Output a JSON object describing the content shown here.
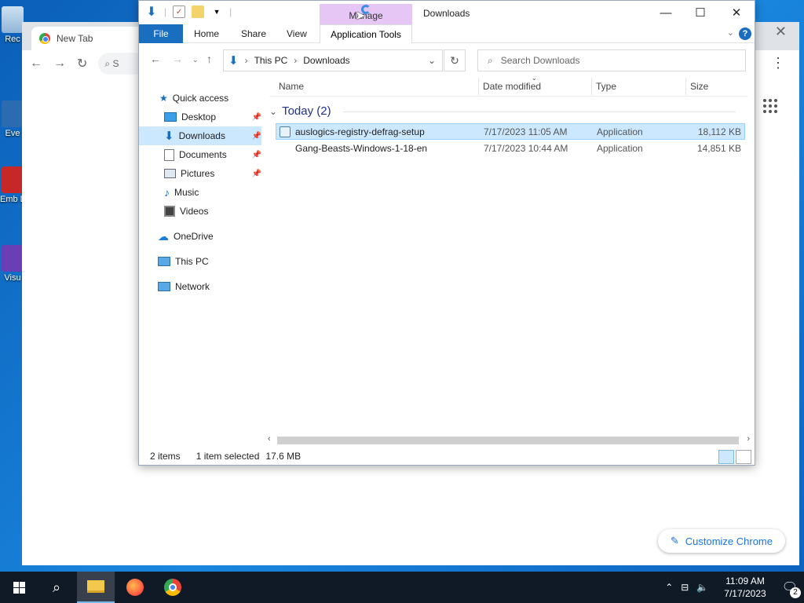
{
  "desktop": {
    "icons": [
      {
        "label": "Rec"
      },
      {
        "label": "Eve"
      },
      {
        "label": "Emb De"
      },
      {
        "label": "Visu"
      }
    ]
  },
  "chrome": {
    "tab_title": "New Tab",
    "omnibox_text": "S",
    "customize_label": "Customize Chrome"
  },
  "explorer": {
    "title": "Downloads",
    "manage_label": "Manage",
    "ribbon_tabs": {
      "file": "File",
      "home": "Home",
      "share": "Share",
      "view": "View",
      "app_tools": "Application Tools"
    },
    "breadcrumb": {
      "this_pc": "This PC",
      "downloads": "Downloads"
    },
    "search_placeholder": "Search Downloads",
    "nav": {
      "quick_access": "Quick access",
      "desktop": "Desktop",
      "downloads": "Downloads",
      "documents": "Documents",
      "pictures": "Pictures",
      "music": "Music",
      "videos": "Videos",
      "onedrive": "OneDrive",
      "this_pc": "This PC",
      "network": "Network"
    },
    "columns": {
      "name": "Name",
      "date": "Date modified",
      "type": "Type",
      "size": "Size"
    },
    "group_label": "Today (2)",
    "files": [
      {
        "name": "auslogics-registry-defrag-setup",
        "date": "7/17/2023 11:05 AM",
        "type": "Application",
        "size": "18,112 KB"
      },
      {
        "name": "Gang-Beasts-Windows-1-18-en",
        "date": "7/17/2023 10:44 AM",
        "type": "Application",
        "size": "14,851 KB"
      }
    ],
    "status": {
      "items": "2 items",
      "selected": "1 item selected",
      "size": "17.6 MB"
    }
  },
  "taskbar": {
    "time": "11:09 AM",
    "date": "7/17/2023",
    "notifications": "2"
  },
  "colors": {
    "accent": "#1a6ec0",
    "selection": "#cce8ff",
    "manage_tab": "#e6c6f5",
    "taskbar": "#101a26"
  }
}
